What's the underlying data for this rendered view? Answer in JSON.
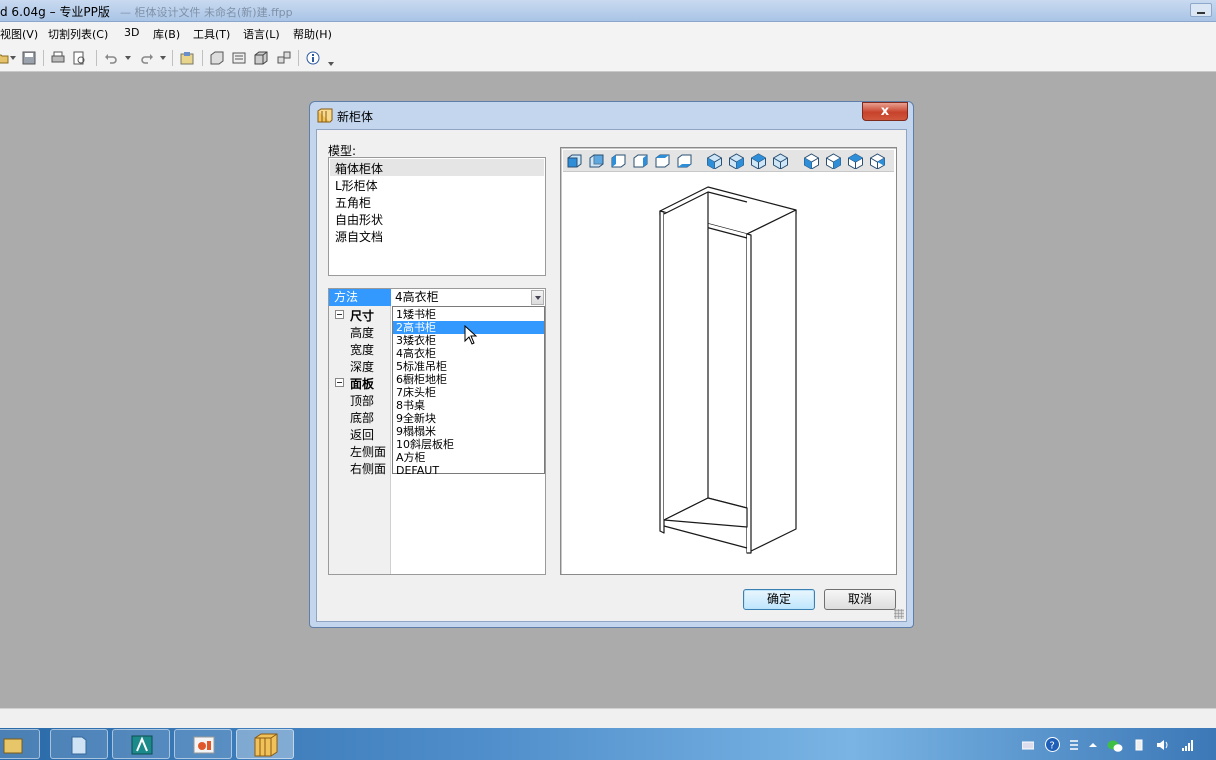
{
  "app": {
    "title": "d 6.04g – 专业PP版",
    "title_blur": "— 柜体设计文件 未命名(新)建.ffpp"
  },
  "menu": [
    {
      "id": "view",
      "label": "视图(V)"
    },
    {
      "id": "cutlist",
      "label": "切割列表(C)"
    },
    {
      "id": "3d",
      "label": "3D"
    },
    {
      "id": "library",
      "label": "库(B)"
    },
    {
      "id": "tools",
      "label": "工具(T)"
    },
    {
      "id": "language",
      "label": "语言(L)"
    },
    {
      "id": "help",
      "label": "帮助(H)"
    }
  ],
  "dialog": {
    "title": "新柜体",
    "close_label": "x",
    "model_label": "模型:",
    "models": [
      "箱体柜体",
      "L形柜体",
      "五角柜",
      "自由形状",
      "源自文档"
    ],
    "selected_model": "箱体柜体",
    "method_label": "方法",
    "method_value": "4高衣柜",
    "properties": {
      "size_group": "尺寸",
      "height": "高度",
      "width": "宽度",
      "depth": "深度",
      "panel_group": "面板",
      "top": "顶部",
      "bottom": "底部",
      "back": "返回",
      "left_side": "左侧面",
      "right_side": "右侧面"
    },
    "dropdown_options": [
      "1矮书柜",
      "2高书柜",
      "3矮衣柜",
      "4高衣柜",
      "5标准吊柜",
      "6橱柜地柜",
      "7床头柜",
      "8书桌",
      "9全新块",
      "9榻榻米",
      "10斜层板柜",
      "A方柜",
      "DEFAUT"
    ],
    "highlighted_option": "2高书柜",
    "ok_label": "确定",
    "cancel_label": "取消"
  },
  "colors": {
    "selection": "#3399ff",
    "close_button": "#c7422b",
    "cube_icon": "#2e8fd8"
  }
}
